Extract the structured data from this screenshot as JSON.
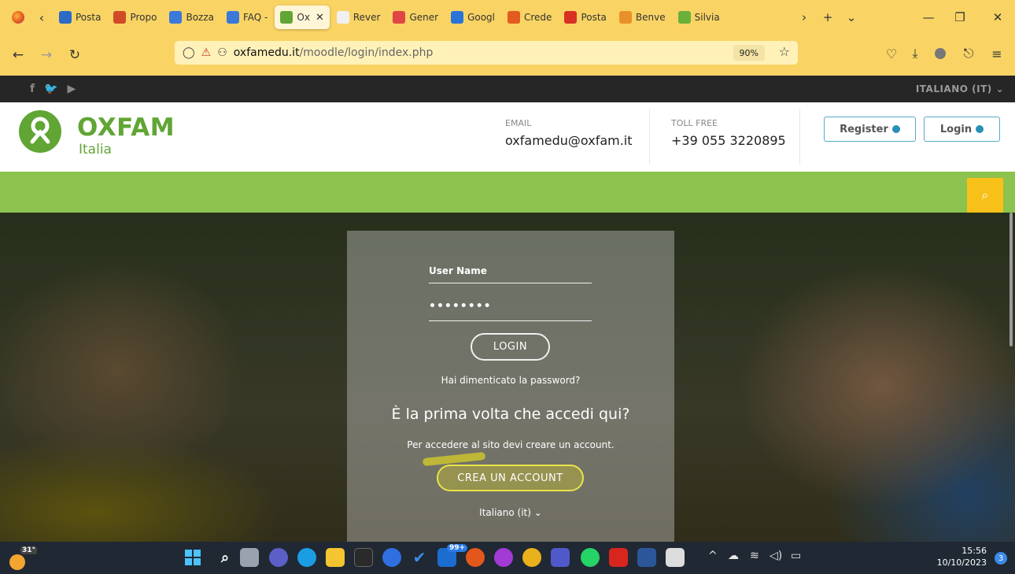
{
  "browser": {
    "tabs": [
      {
        "label": "Posta",
        "color": "#2b6bc7"
      },
      {
        "label": "Propo",
        "color": "#d04a28"
      },
      {
        "label": "Bozza",
        "color": "#3b78d8"
      },
      {
        "label": "FAQ -",
        "color": "#3b78d8"
      },
      {
        "label": "Ox",
        "color": "#61a534",
        "active": true
      },
      {
        "label": "Rever",
        "color": "#f0f0f0"
      },
      {
        "label": "Gener",
        "color": "#e04646"
      },
      {
        "label": "Googl",
        "color": "#2a73d9"
      },
      {
        "label": "Crede",
        "color": "#e35b1e"
      },
      {
        "label": "Posta",
        "color": "#d93025"
      },
      {
        "label": "Benve",
        "color": "#e8912a"
      },
      {
        "label": "Silvia",
        "color": "#6bb03a"
      }
    ],
    "url_host": "oxfamedu.it",
    "url_path": "/moodle/login/index.php",
    "zoom": "90%"
  },
  "site": {
    "language_top": "ITALIANO (IT)",
    "logo_title": "OXFAM",
    "logo_sub": "Italia",
    "email_label": "EMAIL",
    "email_value": "oxfamedu@oxfam.it",
    "phone_label": "TOLL FREE",
    "phone_value": "+39 055 3220895",
    "register_label": "Register",
    "login_header_label": "Login"
  },
  "login_form": {
    "username_placeholder": "User Name",
    "password_masked": "••••••••",
    "login_button": "LOGIN",
    "forgot_password": "Hai dimenticato la password?",
    "first_time_heading": "È la prima volta che accedi qui?",
    "need_account_text": "Per accedere al sito devi creare un account.",
    "create_account_button": "CREA UN ACCOUNT",
    "language_select": "Italiano (it)"
  },
  "taskbar": {
    "weather_temp": "31°",
    "mail_badge": "99+",
    "clock_time": "15:56",
    "clock_date": "10/10/2023",
    "notification_count": "3"
  }
}
